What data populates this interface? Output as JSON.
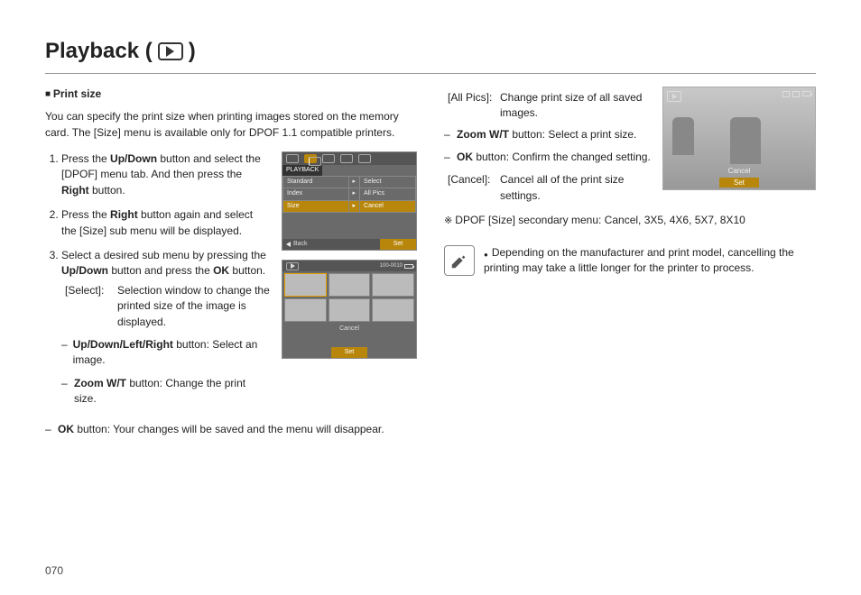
{
  "page": {
    "title_prefix": "Playback (",
    "title_suffix": ")",
    "number": "070"
  },
  "section": {
    "heading": "Print size",
    "intro": "You can specify the print size when printing images stored on the memory card. The [Size] menu is available only for DPOF 1.1 compatible printers."
  },
  "steps": {
    "s1_a": "Press the ",
    "s1_b": " button and select the [DPOF] menu tab. And then press the ",
    "s1_c": " button.",
    "s2_a": "Press the ",
    "s2_b": " button again and select the [Size] sub menu will be displayed.",
    "s3_a": "Select a desired sub menu by pressing the ",
    "s3_b": " button and press the ",
    "s3_c": " button.",
    "sel_label": "[Select]:",
    "sel_text": "Selection window to change the printed size of the image is displayed.",
    "udlr_a": "Up/Down/Left/Right",
    "udlr_b": " button: Select an image.",
    "zoom_a": "Zoom W/T",
    "zoom_b": " button: Change the print size.",
    "ok_a": "OK",
    "ok_b": " button: Your changes will be saved and the menu will disappear.",
    "b_updown": "Up/Down",
    "b_right": "Right",
    "b_ok": "OK"
  },
  "right": {
    "allpics_label": "[All Pics]:",
    "allpics_text": "Change print size of all saved images.",
    "zoom_a": "Zoom W/T",
    "zoom_b": " button: Select a print size.",
    "okconf_a": "OK",
    "okconf_b": " button: Confirm the changed setting.",
    "cancel_label": "[Cancel]:",
    "cancel_text": "Cancel all of the print size settings.",
    "secondary": "DPOF [Size] secondary menu: Cancel, 3X5, 4X6, 5X7, 8X10",
    "note": "Depending on the manufacturer and print model, cancelling the printing may take a little longer for the printer to process."
  },
  "screen1": {
    "header": "PLAYBACK",
    "r1l": "Standard",
    "r1r": "Select",
    "r2l": "Index",
    "r2r": "All Pics",
    "r3l": "Size",
    "r3r": "Cancel",
    "back": "Back",
    "set": "Set"
  },
  "screen2": {
    "counter": "100-0010",
    "cancel": "Cancel",
    "set": "Set"
  },
  "photo": {
    "cancel": "Cancel",
    "set": "Set"
  }
}
